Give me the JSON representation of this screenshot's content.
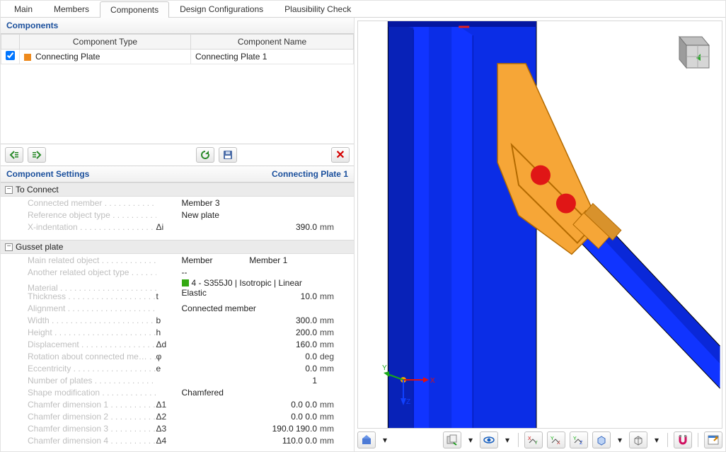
{
  "tabs": [
    "Main",
    "Members",
    "Components",
    "Design Configurations",
    "Plausibility Check"
  ],
  "active_tab": 2,
  "components_panel": {
    "title": "Components",
    "columns": [
      "Component Type",
      "Component Name"
    ],
    "rows": [
      {
        "checked": true,
        "type": "Connecting Plate",
        "name": "Connecting Plate 1"
      }
    ]
  },
  "settings_head": {
    "title": "Component Settings",
    "which": "Connecting Plate 1"
  },
  "settings": [
    {
      "group": "To Connect",
      "rows": [
        {
          "label": "Connected member",
          "sym": "",
          "val": "Member 3",
          "unit": ""
        },
        {
          "label": "Reference object type",
          "sym": "",
          "val": "New plate",
          "unit": ""
        },
        {
          "label": "X-indentation",
          "sym": "Δi",
          "val": "390.0",
          "unit": "mm"
        }
      ]
    },
    {
      "group": "Gusset plate",
      "rows": [
        {
          "label": "Main related object",
          "sym": "",
          "val": "Member",
          "val2": "Member 1",
          "unit": ""
        },
        {
          "label": "Another related object type",
          "sym": "",
          "val": "--",
          "unit": ""
        },
        {
          "label": "Material",
          "sym": "",
          "val": "",
          "material": "4 - S355J0 | Isotropic | Linear Elastic",
          "unit": ""
        },
        {
          "label": "Thickness",
          "sym": "t",
          "val": "10.0",
          "unit": "mm"
        },
        {
          "label": "Alignment",
          "sym": "",
          "val": "Connected member",
          "unit": ""
        },
        {
          "label": "Width",
          "sym": "b",
          "val": "300.0",
          "unit": "mm"
        },
        {
          "label": "Height",
          "sym": "h",
          "val": "200.0",
          "unit": "mm"
        },
        {
          "label": "Displacement",
          "sym": "Δd",
          "val": "160.0",
          "unit": "mm"
        },
        {
          "label": "Rotation about connected me…",
          "sym": "φ",
          "val": "0.0",
          "unit": "deg"
        },
        {
          "label": "Eccentricity",
          "sym": "e",
          "val": "0.0",
          "unit": "mm"
        },
        {
          "label": "Number of plates",
          "sym": "",
          "val": "1",
          "unit": ""
        },
        {
          "label": "Shape modification",
          "sym": "",
          "val": "Chamfered",
          "unit": ""
        },
        {
          "label": "Chamfer dimension 1",
          "sym": "Δ1",
          "val": "0.0 0.0",
          "unit": "mm"
        },
        {
          "label": "Chamfer dimension 2",
          "sym": "Δ2",
          "val": "0.0 0.0",
          "unit": "mm"
        },
        {
          "label": "Chamfer dimension 3",
          "sym": "Δ3",
          "val": "190.0 190.0",
          "unit": "mm"
        },
        {
          "label": "Chamfer dimension 4",
          "sym": "Δ4",
          "val": "110.0 0.0",
          "unit": "mm"
        }
      ]
    }
  ]
}
